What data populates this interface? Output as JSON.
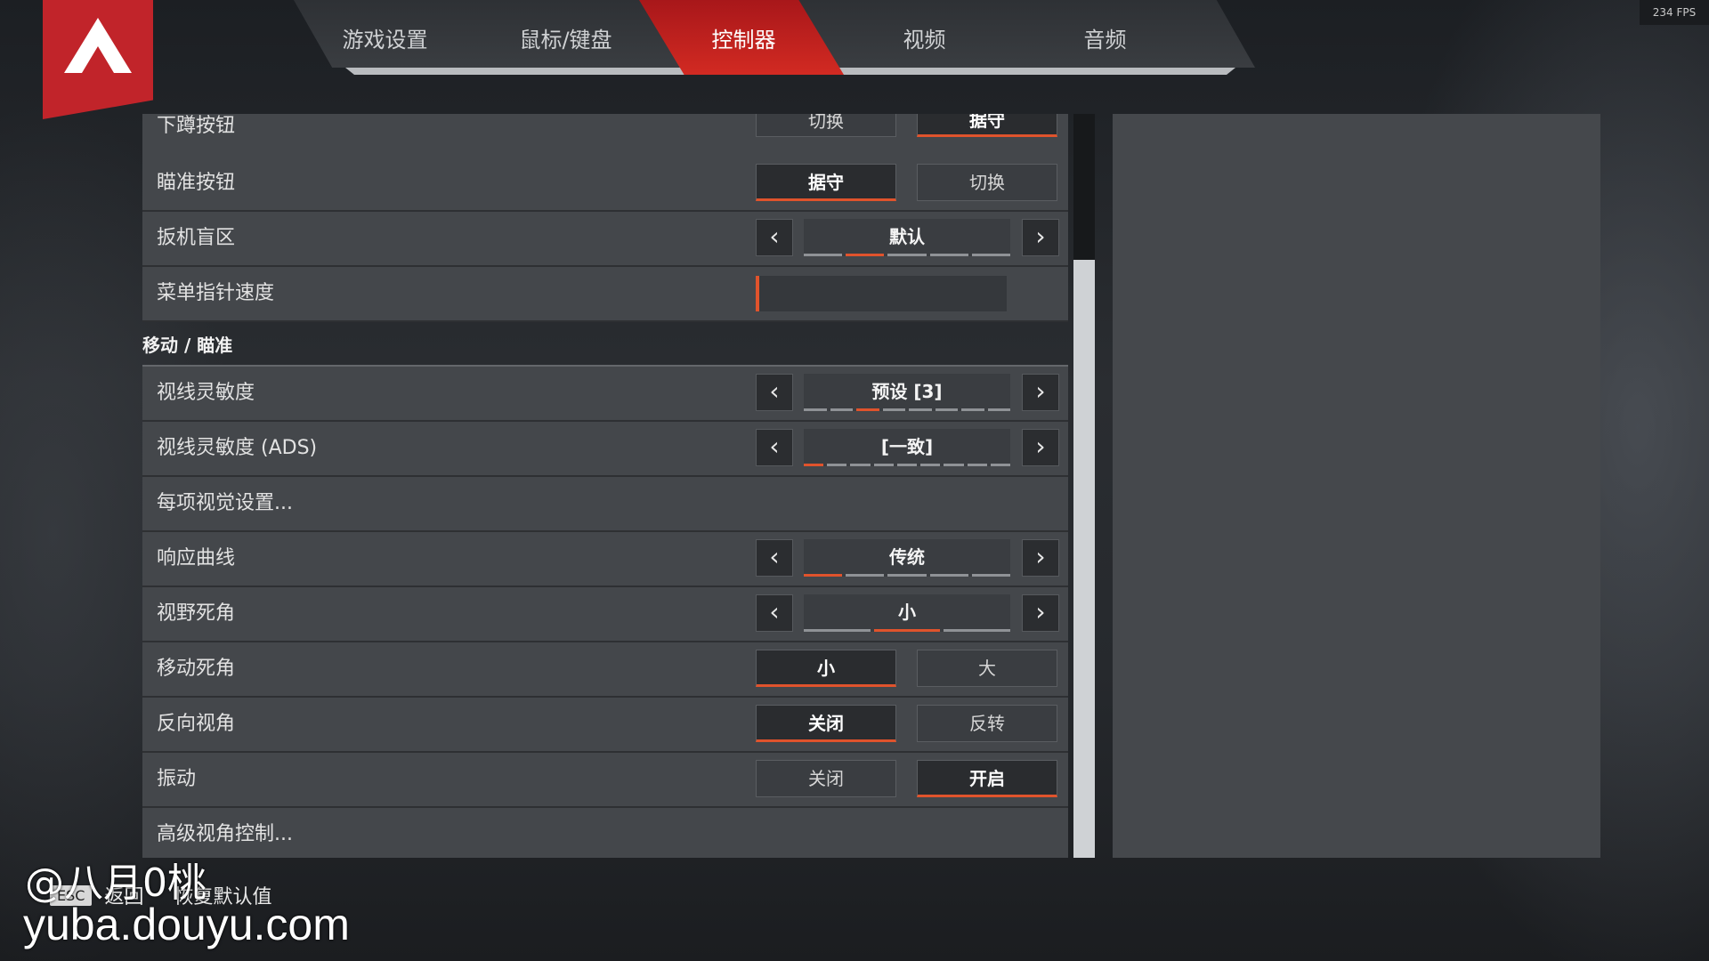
{
  "fps": "234 FPS",
  "tabs": [
    {
      "label": "游戏设置",
      "active": false
    },
    {
      "label": "鼠标/键盘",
      "active": false
    },
    {
      "label": "控制器",
      "active": true
    },
    {
      "label": "视频",
      "active": false
    },
    {
      "label": "音频",
      "active": false
    }
  ],
  "accent_color": "#e0532c",
  "settings": {
    "crouch": {
      "label": "下蹲按钮",
      "options": [
        "切换",
        "据守"
      ],
      "selected": 1
    },
    "aim": {
      "label": "瞄准按钮",
      "options": [
        "据守",
        "切换"
      ],
      "selected": 0
    },
    "trigger_deadzone": {
      "label": "扳机盲区",
      "value": "默认",
      "steps": 5,
      "step_index": 1
    },
    "menu_cursor_speed": {
      "label": "菜单指针速度",
      "level": 0.0
    },
    "section_move_aim": "移动 / 瞄准",
    "look_sensitivity": {
      "label": "视线灵敏度",
      "value": "预设 [3]",
      "steps": 8,
      "step_index": 2
    },
    "look_sensitivity_ads": {
      "label": "视线灵敏度 (ADS)",
      "value": "[一致]",
      "steps": 9,
      "step_index": 0
    },
    "per_optic": {
      "label": "每项视觉设置..."
    },
    "response_curve": {
      "label": "响应曲线",
      "value": "传统",
      "steps": 5,
      "step_index": 0
    },
    "look_deadzone": {
      "label": "视野死角",
      "value": "小",
      "steps": 3,
      "step_index": 1
    },
    "move_deadzone": {
      "label": "移动死角",
      "options": [
        "小",
        "大"
      ],
      "selected": 0
    },
    "invert_look": {
      "label": "反向视角",
      "options": [
        "关闭",
        "反转"
      ],
      "selected": 0
    },
    "vibration": {
      "label": "振动",
      "options": [
        "关闭",
        "开启"
      ],
      "selected": 1
    },
    "advanced_look": {
      "label": "高级视角控制..."
    }
  },
  "footer": {
    "esc_key": "ESC",
    "back": "返回",
    "restore": "恢复默认值"
  },
  "watermark": {
    "line1": "@八月0桃",
    "line2": "yuba.douyu.com"
  }
}
